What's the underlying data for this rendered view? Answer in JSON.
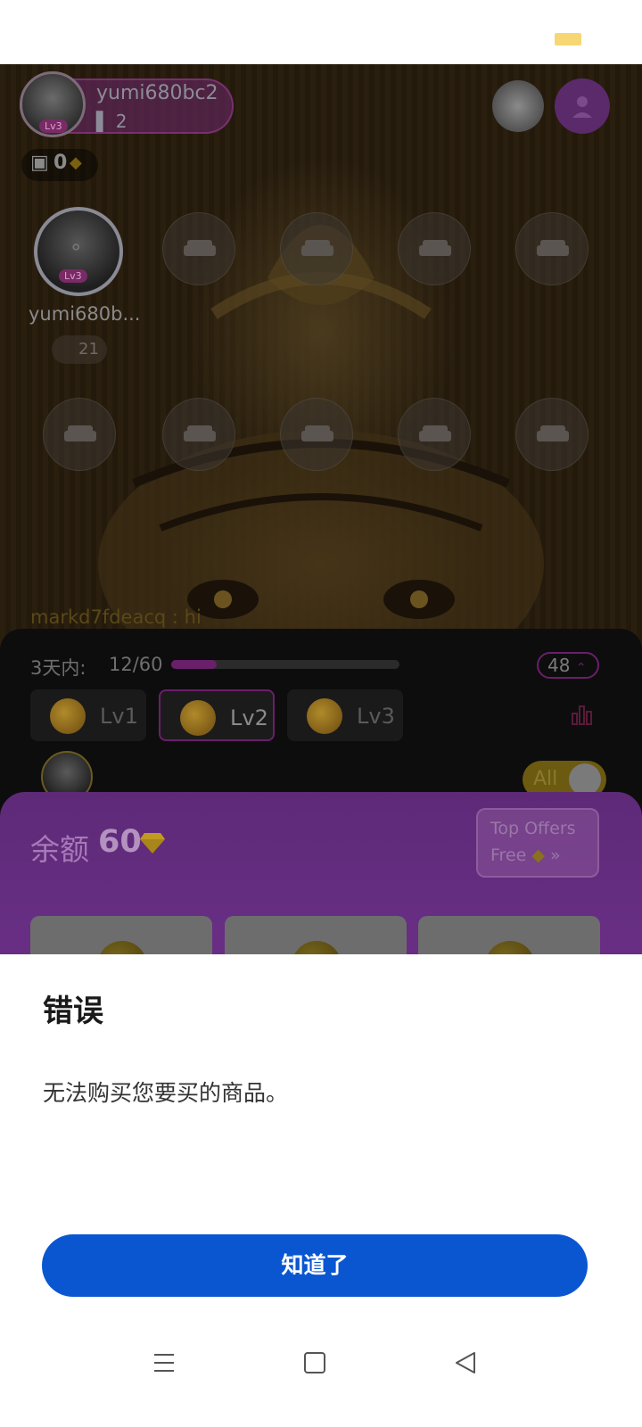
{
  "status_bar": {
    "battery_color": "#f7d774"
  },
  "room": {
    "host": {
      "name": "yumi680bc2",
      "level": "Lv3",
      "count": "2"
    },
    "coins": "0",
    "seats": {
      "host_seat": {
        "name": "yumi680b...",
        "level": "Lv3",
        "score": "21"
      },
      "empty_seat_icon": "sofa-icon"
    },
    "chat": {
      "user": "markd7fdeacq",
      "message": "hi"
    }
  },
  "gift_panel": {
    "progress_label": "3天内:",
    "progress_value": "12/60",
    "progress_fraction": 0.2,
    "level_chip": "48",
    "tiers": [
      {
        "label": "Lv1"
      },
      {
        "label": "Lv2"
      },
      {
        "label": "Lv3"
      }
    ],
    "selected_tier": "Lv2",
    "all_toggle": "All"
  },
  "recharge": {
    "balance_label": "余额",
    "balance_value": "60",
    "offer_line1": "Top Offers",
    "offer_line2": "Free"
  },
  "dialog": {
    "title": "错误",
    "message": "无法购买您要买的商品。",
    "ok_label": "知道了",
    "accent": "#0a56d1"
  },
  "nav": {
    "icons": [
      "menu-icon",
      "home-icon",
      "back-icon"
    ]
  }
}
